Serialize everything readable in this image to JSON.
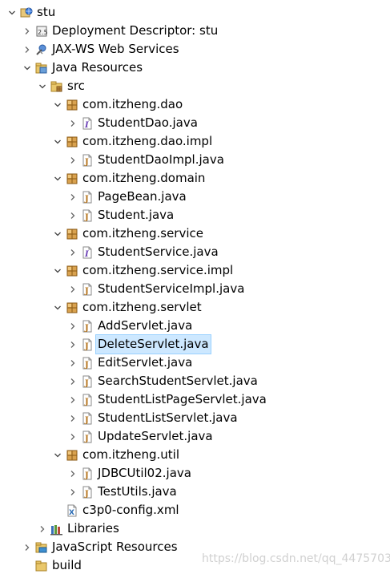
{
  "tree": [
    {
      "label": "stu",
      "level": 0,
      "expanded": true,
      "icon": "web-project-icon"
    },
    {
      "label": "Deployment Descriptor: stu",
      "level": 1,
      "expanded": false,
      "icon": "deployment-descriptor-icon"
    },
    {
      "label": "JAX-WS Web Services",
      "level": 1,
      "expanded": false,
      "icon": "web-services-icon"
    },
    {
      "label": "Java Resources",
      "level": 1,
      "expanded": true,
      "icon": "java-resources-icon"
    },
    {
      "label": "src",
      "level": 2,
      "expanded": true,
      "icon": "source-folder-icon"
    },
    {
      "label": "com.itzheng.dao",
      "level": 3,
      "expanded": true,
      "icon": "package-icon"
    },
    {
      "label": "StudentDao.java",
      "level": 4,
      "expanded": false,
      "icon": "interface-file-icon"
    },
    {
      "label": "com.itzheng.dao.impl",
      "level": 3,
      "expanded": true,
      "icon": "package-icon"
    },
    {
      "label": "StudentDaoImpl.java",
      "level": 4,
      "expanded": false,
      "icon": "java-file-icon"
    },
    {
      "label": "com.itzheng.domain",
      "level": 3,
      "expanded": true,
      "icon": "package-icon"
    },
    {
      "label": "PageBean.java",
      "level": 4,
      "expanded": false,
      "icon": "java-file-icon"
    },
    {
      "label": "Student.java",
      "level": 4,
      "expanded": false,
      "icon": "java-file-icon"
    },
    {
      "label": "com.itzheng.service",
      "level": 3,
      "expanded": true,
      "icon": "package-icon"
    },
    {
      "label": "StudentService.java",
      "level": 4,
      "expanded": false,
      "icon": "interface-file-icon"
    },
    {
      "label": "com.itzheng.service.impl",
      "level": 3,
      "expanded": true,
      "icon": "package-icon"
    },
    {
      "label": "StudentServiceImpl.java",
      "level": 4,
      "expanded": false,
      "icon": "java-file-icon"
    },
    {
      "label": "com.itzheng.servlet",
      "level": 3,
      "expanded": true,
      "icon": "package-icon"
    },
    {
      "label": "AddServlet.java",
      "level": 4,
      "expanded": false,
      "icon": "java-file-icon"
    },
    {
      "label": "DeleteServlet.java",
      "level": 4,
      "expanded": false,
      "icon": "java-file-icon",
      "selected": true
    },
    {
      "label": "EditServlet.java",
      "level": 4,
      "expanded": false,
      "icon": "java-file-icon"
    },
    {
      "label": "SearchStudentServlet.java",
      "level": 4,
      "expanded": false,
      "icon": "java-file-icon"
    },
    {
      "label": "StudentListPageServlet.java",
      "level": 4,
      "expanded": false,
      "icon": "java-file-icon"
    },
    {
      "label": "StudentListServlet.java",
      "level": 4,
      "expanded": false,
      "icon": "java-file-icon"
    },
    {
      "label": "UpdateServlet.java",
      "level": 4,
      "expanded": false,
      "icon": "java-file-icon"
    },
    {
      "label": "com.itzheng.util",
      "level": 3,
      "expanded": true,
      "icon": "package-icon"
    },
    {
      "label": "JDBCUtil02.java",
      "level": 4,
      "expanded": false,
      "icon": "java-file-icon"
    },
    {
      "label": "TestUtils.java",
      "level": 4,
      "expanded": false,
      "icon": "java-file-icon"
    },
    {
      "label": "c3p0-config.xml",
      "level": 3,
      "icon": "xml-file-icon",
      "leaf": true
    },
    {
      "label": "Libraries",
      "level": 2,
      "expanded": false,
      "icon": "libraries-icon"
    },
    {
      "label": "JavaScript Resources",
      "level": 1,
      "expanded": false,
      "icon": "javascript-resources-icon"
    },
    {
      "label": "build",
      "level": 1,
      "icon": "folder-icon",
      "leaf": true
    }
  ],
  "watermark": "https://blog.csdn.net/qq_44757034"
}
